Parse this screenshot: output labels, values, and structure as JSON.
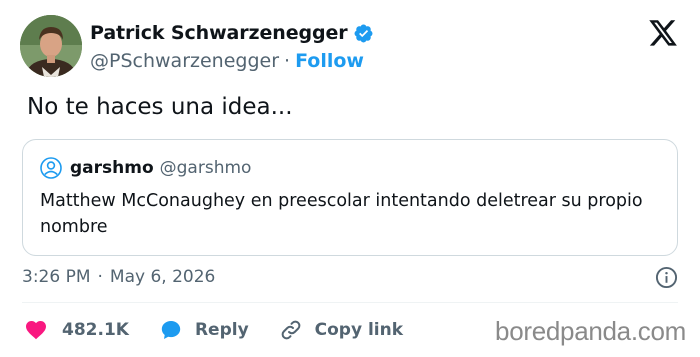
{
  "tweet": {
    "author": {
      "display_name": "Patrick Schwarzenegger",
      "handle": "@PSchwarzenegger",
      "verified_icon": "verified-badge-icon",
      "follow_label": "Follow",
      "separator": "·"
    },
    "text": "No te haces una idea...",
    "quoted": {
      "display_name": "garshmo",
      "handle": "@garshmo",
      "text": "Matthew McConaughey en preescolar intentando deletrear su propio nombre"
    },
    "time": "3:26 PM",
    "meta_separator": "·",
    "date": "May 6, 2026",
    "actions": {
      "like_count": "482.1K",
      "reply_label": "Reply",
      "copy_link_label": "Copy link"
    }
  },
  "branding": {
    "platform_logo": "x-logo",
    "watermark": "boredpanda.com"
  },
  "colors": {
    "accent": "#1d9bf0",
    "like": "#f91880",
    "secondary_text": "#536471",
    "border": "#cfd9de"
  }
}
